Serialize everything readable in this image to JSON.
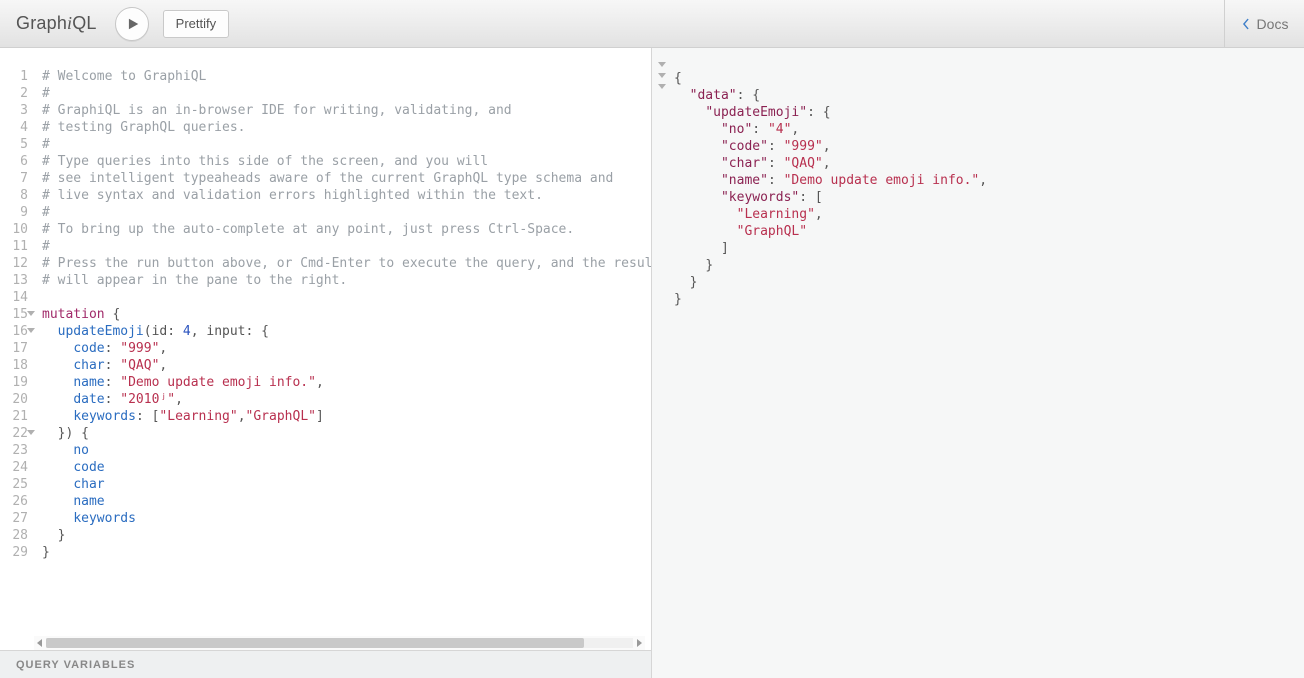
{
  "app": {
    "logo_left": "Graph",
    "logo_i": "i",
    "logo_right": "QL"
  },
  "toolbar": {
    "prettify": "Prettify",
    "docs": "Docs"
  },
  "editor": {
    "line_numbers": [
      1,
      2,
      3,
      4,
      5,
      6,
      7,
      8,
      9,
      10,
      11,
      12,
      13,
      14,
      15,
      16,
      17,
      18,
      19,
      20,
      21,
      22,
      23,
      24,
      25,
      26,
      27,
      28,
      29
    ],
    "fold_lines": [
      15,
      16,
      22
    ],
    "comments": {
      "l1": "# Welcome to GraphiQL",
      "l2": "#",
      "l3": "# GraphiQL is an in-browser IDE for writing, validating, and",
      "l4": "# testing GraphQL queries.",
      "l5": "#",
      "l6": "# Type queries into this side of the screen, and you will",
      "l7": "# see intelligent typeaheads aware of the current GraphQL type schema and",
      "l8": "# live syntax and validation errors highlighted within the text.",
      "l9": "#",
      "l10": "# To bring up the auto-complete at any point, just press Ctrl-Space.",
      "l11": "#",
      "l12": "# Press the run button above, or Cmd-Enter to execute the query, and the result",
      "l13": "# will appear in the pane to the right."
    },
    "mutation_kw": "mutation",
    "fn_name": "updateEmoji",
    "arg_id": "id",
    "arg_id_val": "4",
    "arg_input": "input",
    "fields": {
      "code": "code",
      "char": "char",
      "name": "name",
      "date": "date",
      "keywords": "keywords",
      "no": "no"
    },
    "values": {
      "code": "\"999\"",
      "char": "\"QAQ\"",
      "name": "\"Demo update emoji info.\"",
      "date": "\"2010ʲ\"",
      "kw1": "\"Learning\"",
      "kw2": "\"GraphQL\""
    }
  },
  "qv": {
    "label": "QUERY VARIABLES"
  },
  "result": {
    "keys": {
      "data": "\"data\"",
      "updateEmoji": "\"updateEmoji\"",
      "no": "\"no\"",
      "code": "\"code\"",
      "char": "\"char\"",
      "name": "\"name\"",
      "keywords": "\"keywords\""
    },
    "values": {
      "no": "\"4\"",
      "code": "\"999\"",
      "char": "\"QAQ\"",
      "name": "\"Demo update emoji info.\"",
      "kw1": "\"Learning\"",
      "kw2": "\"GraphQL\""
    }
  }
}
